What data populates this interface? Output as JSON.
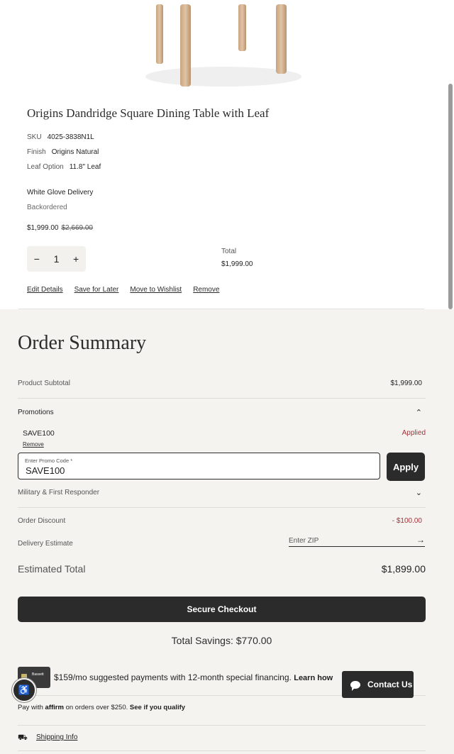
{
  "product": {
    "title": "Origins Dandridge Square Dining Table with Leaf",
    "attributes": [
      {
        "label": "SKU",
        "value": "4025-3838N1L"
      },
      {
        "label": "Finish",
        "value": "Origins Natural"
      },
      {
        "label": "Leaf Option",
        "value": "11.8\" Leaf"
      }
    ],
    "delivery": "White Glove Delivery",
    "availability": "Backordered",
    "price": "$1,999.00",
    "was_price": "$2,669.00",
    "quantity": {
      "minus": "−",
      "value": "1",
      "plus": "+"
    },
    "total_label": "Total",
    "total_value": "$1,999.00",
    "actions": [
      "Edit Details",
      "Save for Later",
      "Move to Wishlist",
      "Remove"
    ]
  },
  "summary": {
    "heading": "Order Summary",
    "subtotal_label": "Product Subtotal",
    "subtotal_value": "$1,999.00",
    "promotions_label": "Promotions",
    "promo_code": "SAVE100",
    "promo_status": "Applied",
    "promo_remove": "Remove",
    "promo_field_label": "Enter Promo Code *",
    "promo_field_value": "SAVE100",
    "apply_label": "Apply",
    "military_label": "Military & First Responder",
    "discount_label": "Order Discount",
    "discount_value": "- $100.00",
    "delivery_label": "Delivery Estimate",
    "zip_placeholder": "Enter ZIP",
    "estimated_label": "Estimated Total",
    "estimated_value": "$1,899.00",
    "checkout_label": "Secure Checkout",
    "savings": "Total Savings: $770.00",
    "financing_text": "$159/mo suggested payments with 12-month special financing.",
    "financing_link": "Learn how",
    "card_brand": "Bassett",
    "affirm_prefix": "Pay with",
    "affirm_logo": "affirm",
    "affirm_suffix": "on orders over $250.",
    "affirm_link": "See if you qualify",
    "shipping_info": "Shipping Info"
  },
  "widgets": {
    "contact_label": "Contact Us"
  },
  "icons": {
    "up": "chevron-up-icon",
    "down": "chevron-down-icon",
    "arrow": "arrow-right-icon",
    "truck": "truck-icon",
    "chat": "chat-icon",
    "accessibility": "accessibility-icon"
  },
  "colors": {
    "dark": "#2b2b2b",
    "accent_red": "#a0343a",
    "summary_bg": "#f4f3ef"
  }
}
